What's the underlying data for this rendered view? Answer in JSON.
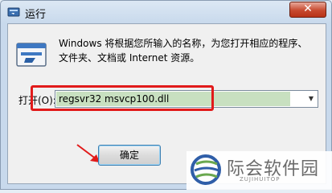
{
  "window": {
    "title": "运行"
  },
  "titlebar": {
    "close_glyph": "✕"
  },
  "dialog": {
    "description_line1": "Windows 将根据您所输入的名称，为您打开相应的程序、",
    "description_line2": "文件夹、文档或 Internet 资源。",
    "open_label": "打开(O):",
    "open_value": "regsvr32 msvcp100.dll",
    "dropdown_glyph": "▼",
    "ok_label": "确定"
  },
  "watermark": {
    "title": "际会软件园",
    "subtitle": "ZUJIHUITOP"
  },
  "icons": {
    "app": "run-app-icon",
    "run": "run-program-icon",
    "arrow": "red-pointer-arrow-icon",
    "logo": "watermark-logo-icon"
  },
  "colors": {
    "highlight": "#e11a1a",
    "close": "#c74a2f",
    "input_selection": "#c8e0c0"
  }
}
